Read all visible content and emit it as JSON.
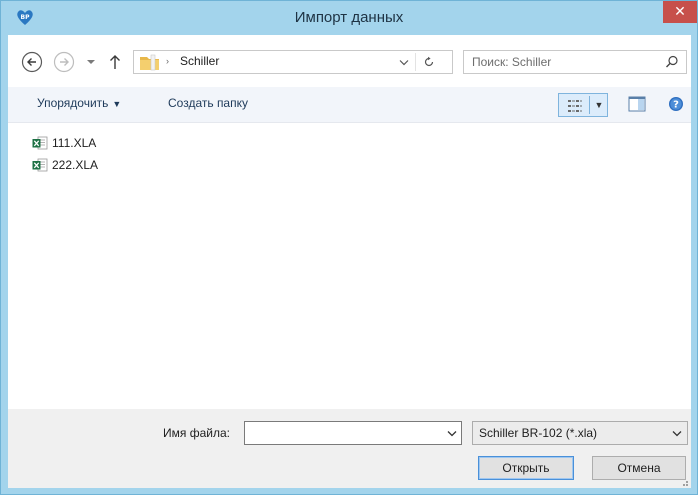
{
  "window": {
    "title": "Импорт данных",
    "close_glyph": "✕",
    "app_icon": "bp-logo-icon"
  },
  "nav": {
    "back_icon": "back-arrow-icon",
    "forward_icon": "forward-arrow-icon",
    "recent_icon": "chevron-down-icon",
    "up_icon": "up-arrow-icon",
    "address": {
      "breadcrumb_separator": "›",
      "path": "Schiller",
      "dropdown_icon": "chevron-down-icon",
      "refresh_icon": "refresh-icon"
    },
    "search": {
      "placeholder": "Поиск: Schiller",
      "value": "",
      "icon": "search-icon"
    }
  },
  "toolbar": {
    "organize_label": "Упорядочить",
    "organize_caret": "▼",
    "new_folder_label": "Создать папку",
    "view_caret": "▼",
    "view_icon": "view-options-icon",
    "preview_pane_icon": "preview-pane-icon",
    "help_icon": "help-icon"
  },
  "files": [
    {
      "name": "111.XLA",
      "icon": "excel-file-icon"
    },
    {
      "name": "222.XLA",
      "icon": "excel-file-icon"
    }
  ],
  "bottom": {
    "filename_label": "Имя файла:",
    "filename_value": "",
    "filter_value": "Schiller BR-102 (*.xla)",
    "open_label": "Открыть",
    "cancel_label": "Отмена"
  },
  "colors": {
    "frame": "#a3d4ec",
    "close_button": "#c7504b",
    "toolbar_bg": "#f2f5fa",
    "excel_green": "#1e7145",
    "folder_yellow": "#e8b84a"
  }
}
